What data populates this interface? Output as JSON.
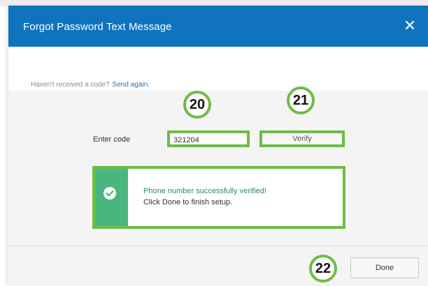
{
  "dialog": {
    "title": "Forgot Password Text Message",
    "close_label": "×"
  },
  "resend": {
    "prompt": "Haven't received a code?",
    "link": "Send again."
  },
  "verify_form": {
    "label": "Enter code",
    "code_value": "321204",
    "verify_label": "Verify"
  },
  "success": {
    "line1": "Phone number successfully verified!",
    "line2": "Click Done to finish setup."
  },
  "footer": {
    "done_label": "Done"
  },
  "annotations": {
    "badge_20": "20",
    "badge_21": "21",
    "badge_22": "22"
  },
  "colors": {
    "header": "#0f74bd",
    "success_strip": "#4ab57d",
    "highlight": "#6cbd45",
    "link": "#1a73b8"
  },
  "icons": {
    "close": "close-icon",
    "check": "check-circle-icon"
  }
}
